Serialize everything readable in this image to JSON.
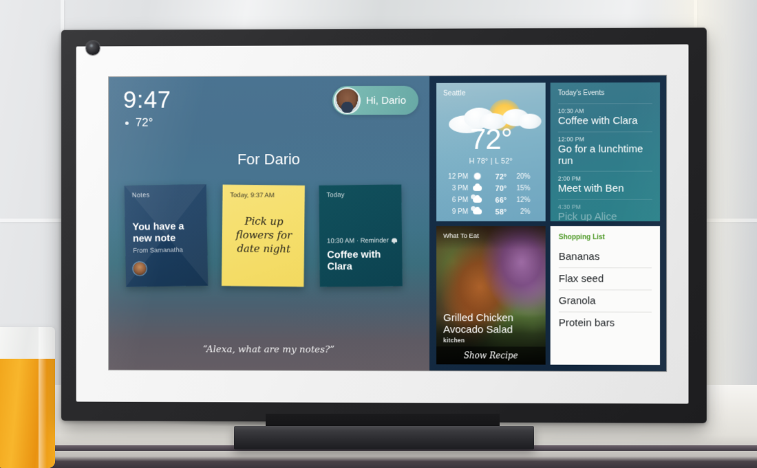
{
  "device": {
    "name": "smart-display"
  },
  "screen": {
    "clock": {
      "time": "9:47",
      "temperature": "72°",
      "weather_icon": "sun-icon"
    },
    "greeting": {
      "text": "Hi, Dario",
      "avatar_icon": "user-avatar"
    },
    "section_title": "For Dario",
    "cards": [
      {
        "label": "Notes",
        "title": "You have a new note",
        "from": "From Samanatha",
        "avatar_icon": "sender-avatar"
      },
      {
        "label": "Today, 9:37 AM",
        "body": "Pick up flowers for date night"
      },
      {
        "label": "Today",
        "meta": "10:30 AM · Reminder",
        "meta_icon": "bell-icon",
        "title": "Coffee with Clara"
      }
    ],
    "alexa_prompt": "“Alexa, what are my notes?”",
    "widgets": {
      "weather": {
        "city": "Seattle",
        "temperature": "72°",
        "high_low": "H 78° | L 52°",
        "icon": "sun-behind-cloud-icon",
        "hourly": [
          {
            "time": "12 PM",
            "icon": "sun-icon",
            "temp": "72°",
            "precip": "20%"
          },
          {
            "time": "3 PM",
            "icon": "cloud-icon",
            "temp": "70°",
            "precip": "15%"
          },
          {
            "time": "6 PM",
            "icon": "sun-behind-cloud-icon",
            "temp": "66°",
            "precip": "12%"
          },
          {
            "time": "9 PM",
            "icon": "sun-behind-cloud-icon",
            "temp": "58°",
            "precip": "2%"
          }
        ]
      },
      "events": {
        "header": "Today's Events",
        "items": [
          {
            "time": "10:30 AM",
            "name": "Coffee with Clara"
          },
          {
            "time": "12:00 PM",
            "name": "Go for a lunchtime run"
          },
          {
            "time": "2:00 PM",
            "name": "Meet with Ben"
          },
          {
            "time": "4:30 PM",
            "name": "Pick up Alice"
          }
        ]
      },
      "recipe": {
        "label": "What To Eat",
        "title": "Grilled Chicken Avocado Salad",
        "brand": "kitchen",
        "cta": "Show Recipe"
      },
      "shopping": {
        "header": "Shopping List",
        "items": [
          "Bananas",
          "Flax seed",
          "Granola",
          "Protein bars"
        ]
      }
    }
  },
  "colors": {
    "accent_teal": "#83c5b9",
    "shopping_green": "#4f9a28",
    "sticky_yellow": "#f6e070",
    "panel_navy": "#14304a"
  }
}
